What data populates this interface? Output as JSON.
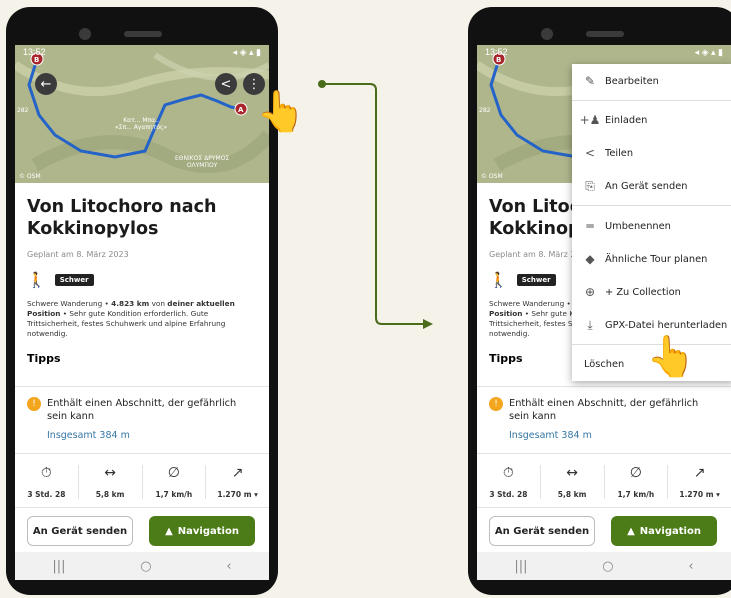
{
  "status": {
    "time": "13:52"
  },
  "map": {
    "osm": "© OSM",
    "label_center": "Κατ... Μπα..\n«Σπ... Αγαπητός»",
    "label_right": "ΕΘΝΙΚΟΣ ΔΡΥΜΟΣ\nΟΛΥΜΠΟΥ",
    "label_left": "282"
  },
  "detail": {
    "title": "Von Litochoro nach Kokkinopylos",
    "planned": "Geplant am 8. März 2023",
    "difficulty": "Schwer",
    "desc_pre": "Schwere Wanderung • ",
    "desc_dist": "4.823 km",
    "desc_mid": " von ",
    "desc_bold": "deiner aktuellen Position",
    "desc_post": " • Sehr gute Kondition erforderlich. Gute Trittsicherheit, festes Schuhwerk und alpine Erfahrung notwendig.",
    "tipps": "Tipps",
    "tip": "Enthält einen Abschnitt, der gefährlich sein kann",
    "tip_link": "Insgesamt 384 m"
  },
  "stats": [
    {
      "icon": "stopwatch-icon",
      "val": "3 Std. 28"
    },
    {
      "icon": "distance-icon",
      "val": "5,8 km"
    },
    {
      "icon": "speed-icon",
      "val": "1,7 km/h"
    },
    {
      "icon": "ascent-icon",
      "val": "1.270 m ▾"
    }
  ],
  "buttons": {
    "send": "An Gerät senden",
    "nav": "Navigation"
  },
  "menu": [
    {
      "icon": "pencil-icon",
      "label": "Bearbeiten"
    },
    {
      "icon": "invite-icon",
      "label": "Einladen"
    },
    {
      "icon": "share-icon",
      "label": "Teilen"
    },
    {
      "icon": "send-to-device-icon",
      "label": "An Gerät senden"
    },
    {
      "icon": "rename-icon",
      "label": "Umbenennen"
    },
    {
      "icon": "similar-tour-icon",
      "label": "Ähnliche Tour planen"
    },
    {
      "icon": "add-collection-icon",
      "label": "+ Zu Collection"
    },
    {
      "icon": "download-icon",
      "label": "GPX-Datei herunterladen"
    },
    {
      "icon": "",
      "label": "Löschen"
    }
  ],
  "colors": {
    "accent": "#4c7c18",
    "route": "#2463c7",
    "marker": "#a8262b",
    "link": "#3777a5",
    "warning": "#f2a51d"
  }
}
